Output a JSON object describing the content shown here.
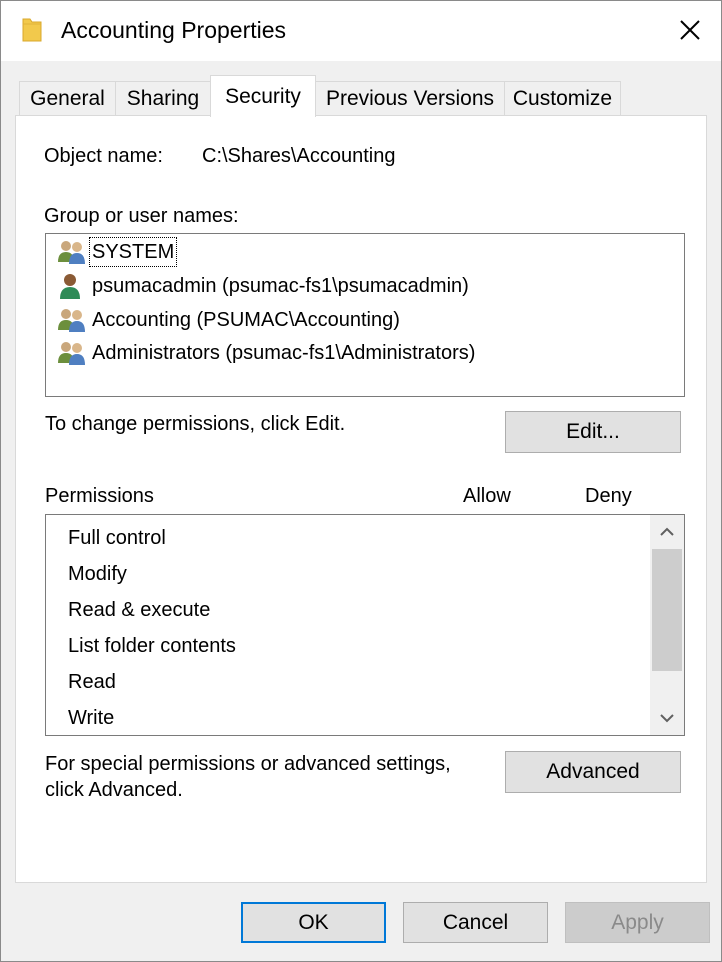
{
  "window": {
    "title": "Accounting Properties"
  },
  "tabs": [
    {
      "label": "General"
    },
    {
      "label": "Sharing"
    },
    {
      "label": "Security"
    },
    {
      "label": "Previous Versions"
    },
    {
      "label": "Customize"
    }
  ],
  "active_tab": "Security",
  "object": {
    "label": "Object name:",
    "value": "C:\\Shares\\Accounting"
  },
  "groups": {
    "label": "Group or user names:",
    "items": [
      {
        "name": "SYSTEM",
        "icon": "group-users-icon"
      },
      {
        "name": "psumacadmin (psumac-fs1\\psumacadmin)",
        "icon": "single-user-icon"
      },
      {
        "name": "Accounting (PSUMAC\\Accounting)",
        "icon": "group-users-icon"
      },
      {
        "name": "Administrators (psumac-fs1\\Administrators)",
        "icon": "group-users-icon"
      }
    ]
  },
  "change_hint": "To change permissions, click Edit.",
  "edit_button": "Edit...",
  "permissions": {
    "label": "Permissions",
    "allow_header": "Allow",
    "deny_header": "Deny",
    "items": [
      {
        "name": "Full control"
      },
      {
        "name": "Modify"
      },
      {
        "name": "Read & execute"
      },
      {
        "name": "List folder contents"
      },
      {
        "name": "Read"
      },
      {
        "name": "Write"
      }
    ]
  },
  "advanced": {
    "hint_line1": "For special permissions or advanced settings,",
    "hint_line2": "click Advanced.",
    "button": "Advanced"
  },
  "footer": {
    "ok": "OK",
    "cancel": "Cancel",
    "apply": "Apply"
  },
  "colors": {
    "accent": "#0078d7",
    "dialog_bg": "#f0f0f0",
    "panel_bg": "#ffffff",
    "folder_icon": "#f2c94c"
  }
}
